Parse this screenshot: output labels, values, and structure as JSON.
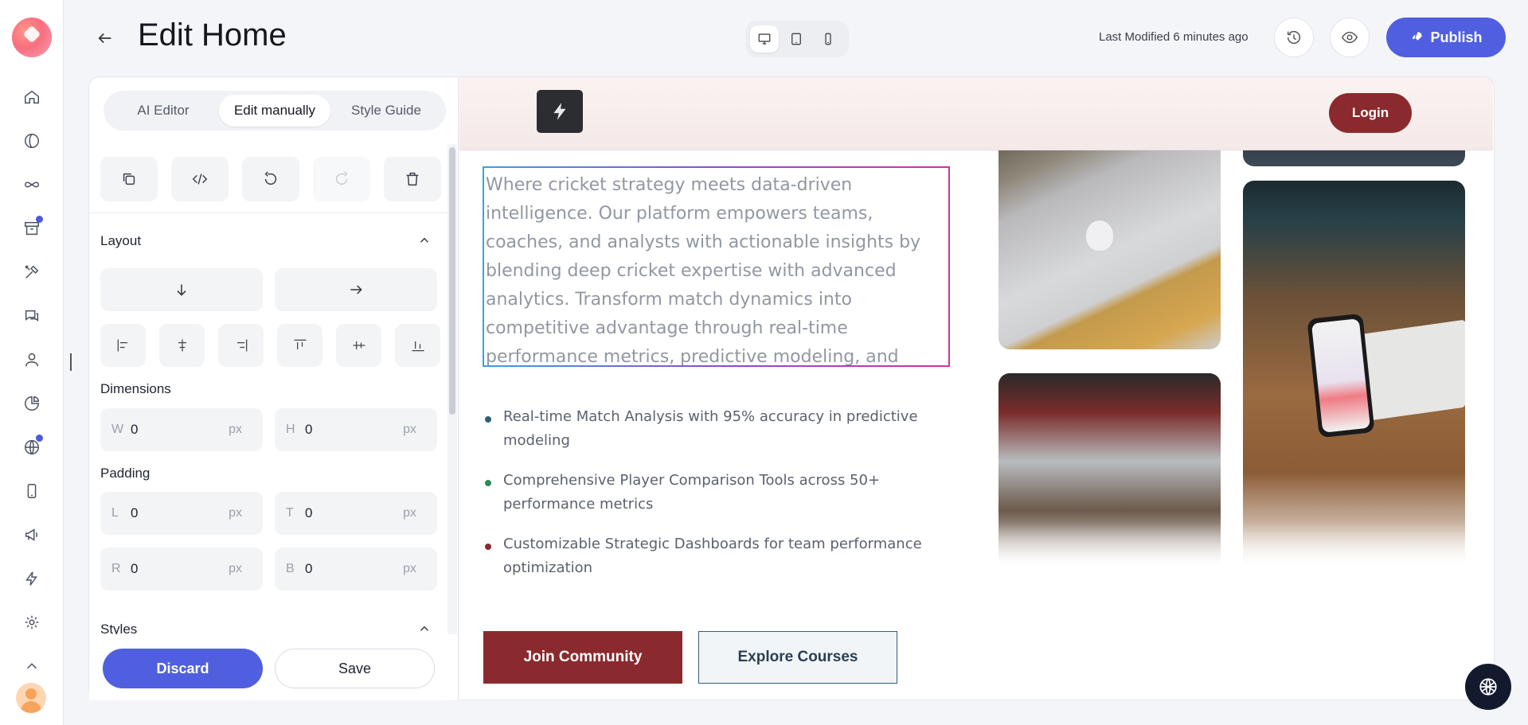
{
  "header": {
    "title": "Edit Home",
    "last_modified": "Last Modified 6 minutes ago",
    "publish_label": "Publish"
  },
  "rail": {
    "items": [
      "home",
      "compass",
      "infinity",
      "archive",
      "tools",
      "chat",
      "user",
      "chart-pie",
      "globe",
      "mobile",
      "megaphone",
      "bolt",
      "settings",
      "chevron-up"
    ]
  },
  "panel": {
    "tabs": [
      {
        "label": "AI Editor",
        "active": false
      },
      {
        "label": "Edit manually",
        "active": true
      },
      {
        "label": "Style Guide",
        "active": false
      }
    ],
    "layout_title": "Layout",
    "dimensions_title": "Dimensions",
    "padding_title": "Padding",
    "styles_title": "Styles",
    "width": {
      "prefix": "W",
      "value": "0",
      "unit": "px"
    },
    "height": {
      "prefix": "H",
      "value": "0",
      "unit": "px"
    },
    "pad_left": {
      "prefix": "L",
      "value": "0",
      "unit": "px"
    },
    "pad_top": {
      "prefix": "T",
      "value": "0",
      "unit": "px"
    },
    "pad_right": {
      "prefix": "R",
      "value": "0",
      "unit": "px"
    },
    "pad_bottom": {
      "prefix": "B",
      "value": "0",
      "unit": "px"
    },
    "discard_label": "Discard",
    "save_label": "Save"
  },
  "site": {
    "login_label": "Login",
    "paragraph": "Where cricket strategy meets data-driven intelligence. Our platform empowers teams, coaches, and analysts with actionable insights by blending deep cricket expertise with advanced analytics. Transform match dynamics into competitive advantage through real-time performance metrics, predictive modeling, and strategic intelligence. Join our community to explore",
    "features": [
      {
        "text": "Real-time Match Analysis with 95% accuracy in predictive modeling",
        "color": "#2f5e7c"
      },
      {
        "text": "Comprehensive Player Comparison Tools across 50+ performance metrics",
        "color": "#2e8b57"
      },
      {
        "text": "Customizable Strategic Dashboards for team performance optimization",
        "color": "#8b2a2e"
      }
    ],
    "join_label": "Join Community",
    "explore_label": "Explore Courses"
  },
  "colors": {
    "accent": "#4f5fe0",
    "brand": "#8b2a2e",
    "teal": "#2f5e7c"
  }
}
